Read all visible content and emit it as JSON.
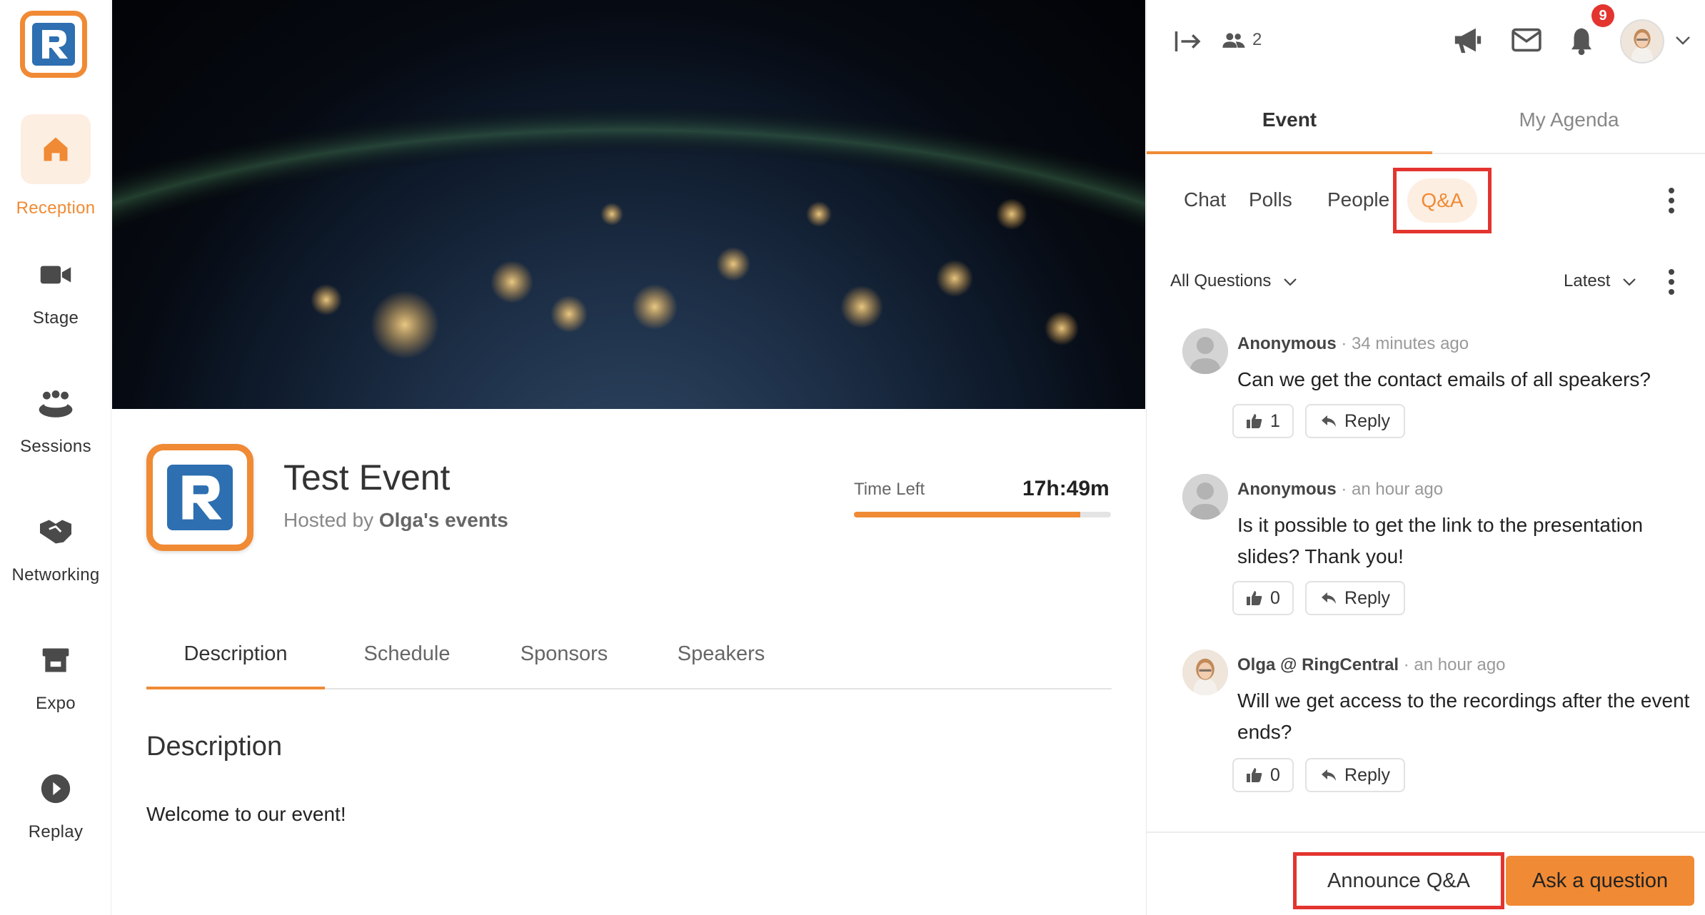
{
  "app": {
    "brand_color": "#f08a34",
    "logo_blue": "#2d6fb1",
    "highlight_red": "#e3342f"
  },
  "leftnav": {
    "items": [
      {
        "label": "Reception",
        "icon": "home-icon",
        "active": true
      },
      {
        "label": "Stage",
        "icon": "video-camera-icon"
      },
      {
        "label": "Sessions",
        "icon": "group-icon"
      },
      {
        "label": "Networking",
        "icon": "handshake-icon"
      },
      {
        "label": "Expo",
        "icon": "booth-icon"
      },
      {
        "label": "Replay",
        "icon": "play-circle-icon"
      }
    ]
  },
  "event": {
    "title": "Test Event",
    "hosted_prefix": "Hosted by",
    "host": "Olga's events",
    "time_left_label": "Time Left",
    "time_left_value": "17h:49m",
    "time_progress": 0.88,
    "tabs": [
      "Description",
      "Schedule",
      "Sponsors",
      "Speakers"
    ],
    "description_heading": "Description",
    "description_text": "Welcome to our event!"
  },
  "right_panel": {
    "topbar": {
      "attendee_count": "2",
      "notification_count": "9"
    },
    "main_tabs": [
      "Event",
      "My Agenda"
    ],
    "sub_tabs": [
      "Chat",
      "Polls",
      "People",
      "Q&A"
    ],
    "filter": {
      "left": "All Questions",
      "right": "Latest"
    },
    "questions": [
      {
        "author": "Anonymous",
        "time": "34 minutes ago",
        "text": "Can we get the contact emails of all speakers?",
        "likes": "1",
        "reply_label": "Reply"
      },
      {
        "author": "Anonymous",
        "time": "an hour ago",
        "text": "Is it possible to get the link to the presentation slides? Thank you!",
        "likes": "0",
        "reply_label": "Reply"
      },
      {
        "author": "Olga @ RingCentral",
        "time": "an hour ago",
        "text": "Will we get access to the recordings after the event ends?",
        "likes": "0",
        "reply_label": "Reply"
      }
    ],
    "footer": {
      "announce_label": "Announce Q&A",
      "ask_label": "Ask a question"
    }
  }
}
